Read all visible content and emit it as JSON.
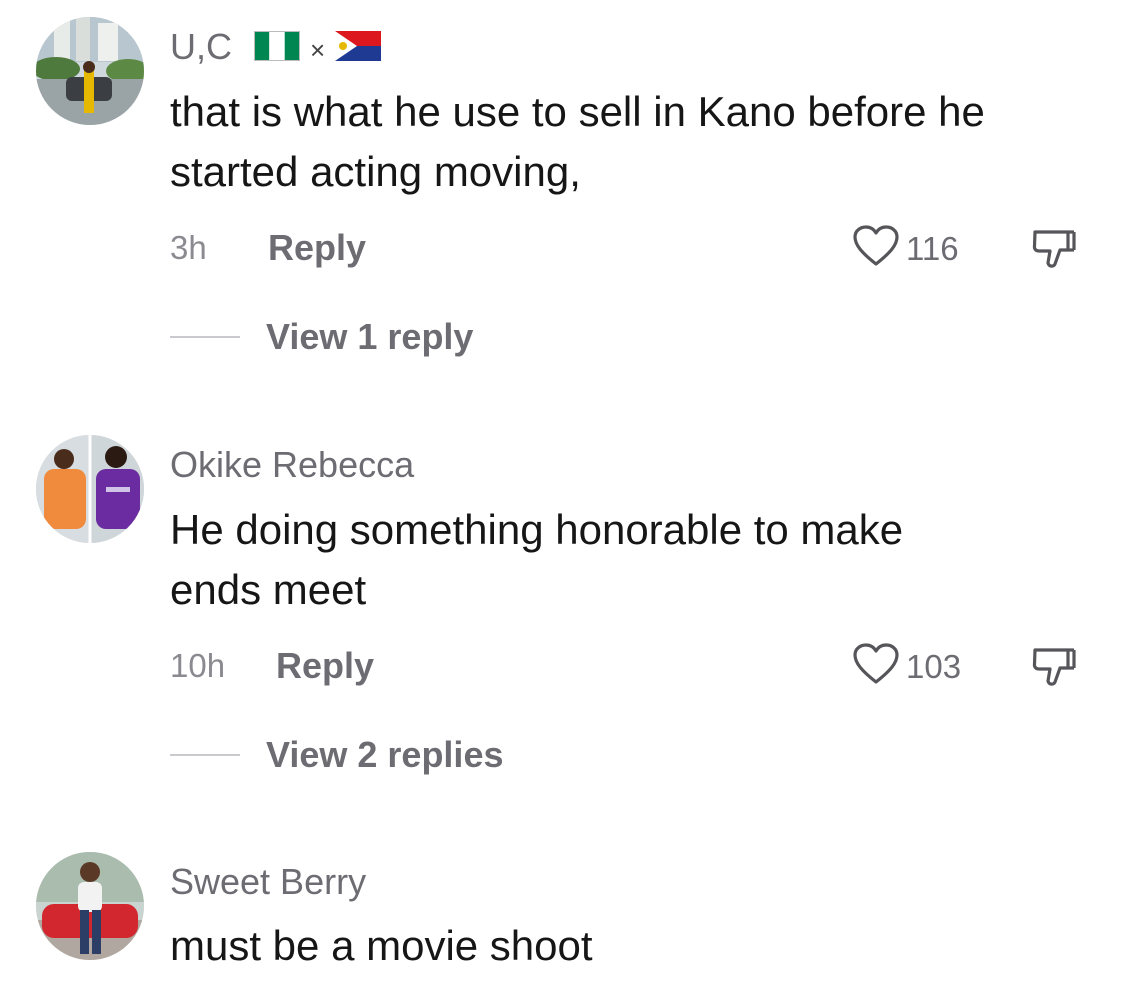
{
  "comments": [
    {
      "username": "U,C",
      "separator": "×",
      "text_line1": "that is what he use to sell in Kano before he",
      "text_line2": "started acting moving,",
      "time": "3h",
      "reply_label": "Reply",
      "likes": "116",
      "view_replies": "View 1 reply"
    },
    {
      "username": "Okike Rebecca",
      "text_line1": "He doing something honorable to make",
      "text_line2": "ends meet",
      "time": "10h",
      "reply_label": "Reply",
      "likes": "103",
      "view_replies": "View 2 replies"
    },
    {
      "username": "Sweet Berry",
      "text_line1": "must be a movie shoot"
    }
  ],
  "colors": {
    "text": "#161616",
    "muted": "#6c6c72",
    "time": "#8a8a90"
  },
  "icons": [
    "heart-icon",
    "dislike-icon",
    "nigeria-flag-icon",
    "sint-maarten-flag-icon"
  ]
}
